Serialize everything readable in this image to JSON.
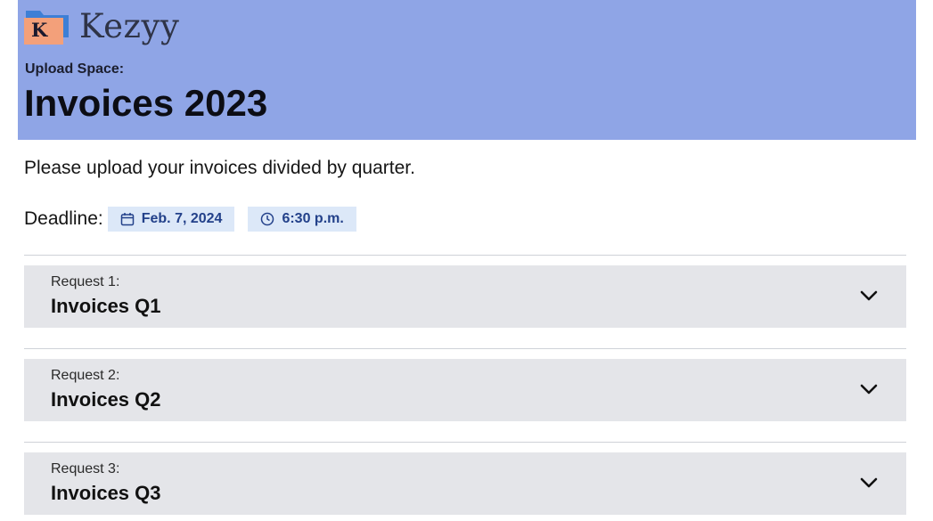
{
  "brand": {
    "name": "Kezyy",
    "logo_letter": "K",
    "icon": "folder-logo-icon",
    "colors": {
      "folder_back": "#3d7fd6",
      "folder_front": "#f3a07a"
    }
  },
  "header": {
    "background": "#8fa5e6",
    "upload_label": "Upload Space:",
    "title": "Invoices 2023"
  },
  "instructions": "Please upload your invoices divided by quarter.",
  "deadline": {
    "label": "Deadline:",
    "date": "Feb. 7, 2024",
    "date_icon": "calendar-icon",
    "time": "6:30 p.m.",
    "time_icon": "clock-icon",
    "chip_color": "#dce8f8",
    "chip_text_color": "#23418a"
  },
  "requests": [
    {
      "number_label": "Request 1:",
      "title": "Invoices Q1",
      "icon": "chevron-down-icon"
    },
    {
      "number_label": "Request 2:",
      "title": "Invoices Q2",
      "icon": "chevron-down-icon"
    },
    {
      "number_label": "Request 3:",
      "title": "Invoices Q3",
      "icon": "chevron-down-icon"
    }
  ]
}
